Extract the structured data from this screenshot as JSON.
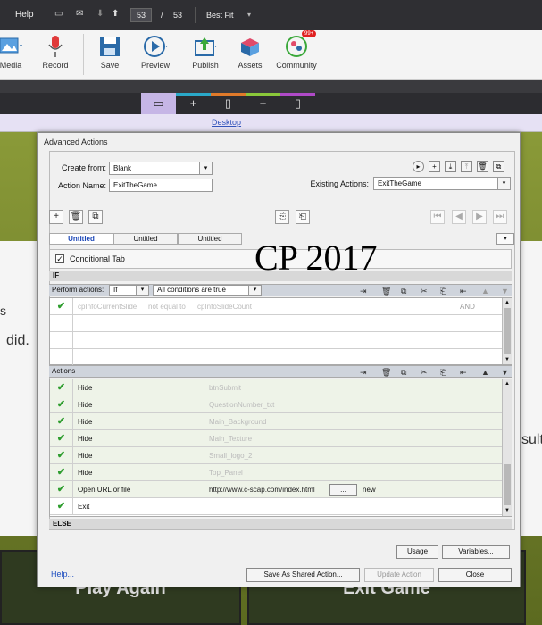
{
  "topbar": {
    "help": "Help",
    "page_current": "53",
    "slash": "/",
    "page_total": "53",
    "zoom": "Best Fit"
  },
  "toolbar": {
    "media": "Media",
    "record": "Record",
    "save": "Save",
    "preview": "Preview",
    "publish": "Publish",
    "assets": "Assets",
    "community": "Community",
    "community_badge": "99+"
  },
  "device_bar": {
    "desktop_label": "Desktop"
  },
  "slide": {
    "text1": "s",
    "text2": "did.",
    "text3": "sult",
    "button1": "Play Again",
    "button2": "Exit Game"
  },
  "dialog": {
    "title": "Advanced Actions",
    "create_from_label": "Create from:",
    "create_from_value": "Blank",
    "action_name_label": "Action Name:",
    "action_name_value": "ExitTheGame",
    "existing_actions_label": "Existing Actions:",
    "existing_actions_value": "ExitTheGame",
    "tabs": [
      "Untitled",
      "Untitled",
      "Untitled"
    ],
    "conditional_tab_label": "Conditional Tab",
    "if_label": "IF",
    "perform_actions_label": "Perform actions:",
    "perform_select": "If",
    "conditions_select": "All conditions are true",
    "condition_row": {
      "var": "cpInfoCurrentSlide",
      "op": "not equal to",
      "val": "cpInfoSlideCount",
      "logic": "AND"
    },
    "actions_label": "Actions",
    "actions": [
      {
        "action": "Hide",
        "target": "btnSubmit"
      },
      {
        "action": "Hide",
        "target": "QuestionNumber_txt"
      },
      {
        "action": "Hide",
        "target": "Main_Background"
      },
      {
        "action": "Hide",
        "target": "Main_Texture"
      },
      {
        "action": "Hide",
        "target": "Small_logo_2"
      },
      {
        "action": "Hide",
        "target": "Top_Panel"
      },
      {
        "action": "Open URL or file",
        "target": "http://www.c-scap.com/index.html",
        "dots": "...",
        "window": "new"
      },
      {
        "action": "Exit",
        "target": ""
      }
    ],
    "else_label": "ELSE",
    "usage_button": "Usage",
    "variables_button": "Variables...",
    "help_link": "Help...",
    "save_shared_button": "Save As Shared Action...",
    "update_button": "Update Action",
    "close_button": "Close"
  },
  "overlay_text": "CP 2017",
  "colors": {
    "accent_purple": "#c6b6e6",
    "check_green": "#2e9d2e",
    "link_blue": "#2050c0"
  }
}
